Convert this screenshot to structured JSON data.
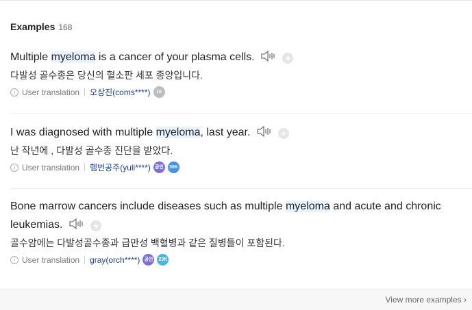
{
  "header": {
    "title": "Examples",
    "count": "168"
  },
  "examples": [
    {
      "before": "Multiple ",
      "keyword": "myeloma",
      "after": " is a cancer of your plasma cells.",
      "translation": "다발성 골수종은 당신의 혈소판 세포 종양입니다.",
      "source_label": "User translation",
      "user": "오상진(coms****)",
      "badges": [
        {
          "text": "10",
          "color": "#bdbdbd"
        }
      ]
    },
    {
      "before": "I was diagnosed with multiple ",
      "keyword": "myeloma",
      "after": ", last year.",
      "translation": "난 작년에 , 다발성 골수종 진단을 받았다.",
      "source_label": "User translation",
      "user": "헴번공주(yuli****)",
      "badges": [
        {
          "text": "공인",
          "color": "#7b6fd6"
        },
        {
          "text": "30K",
          "color": "#4a90e2"
        }
      ]
    },
    {
      "before": "Bone marrow cancers include diseases such as multiple ",
      "keyword": "myeloma",
      "after": " and acute and chronic",
      "after2": "leukemias.",
      "translation": "골수암에는 다발성골수종과 급만성 백혈병과 같은 질병들이 포함된다.",
      "source_label": "User translation",
      "user": "gray(orch****)",
      "badges": [
        {
          "text": "공인",
          "color": "#7b6fd6"
        },
        {
          "text": "23K",
          "color": "#4ab3e2"
        }
      ]
    }
  ],
  "icons": {
    "audio": "speaker-icon",
    "add": "plus-icon",
    "info": "info-icon",
    "more": "chevron-right-icon"
  },
  "footer": {
    "more_label": "View more examples"
  }
}
